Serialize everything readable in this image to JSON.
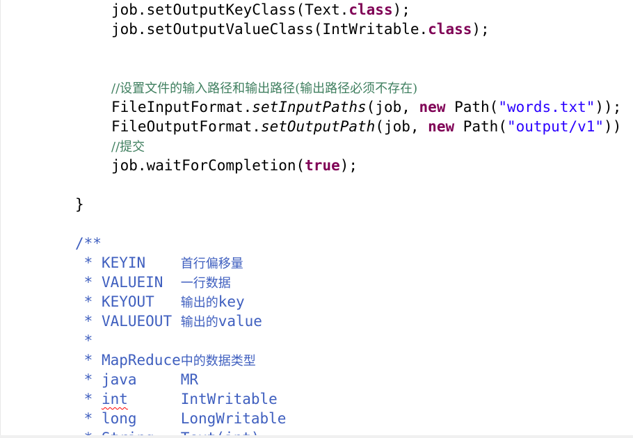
{
  "code": {
    "l1": {
      "pre": "job.setOutputKeyClass(Text.",
      "kw": "class",
      "post": ");"
    },
    "l2": {
      "pre": "job.setOutputValueClass(IntWritable.",
      "kw": "class",
      "post": ");"
    },
    "l3": {
      "comment": "//设置文件的输入路径和输出路径(输出路径必须不存在)"
    },
    "l4": {
      "pre": "FileInputFormat.",
      "method": "setInputPaths",
      "mid": "(job, ",
      "kw": "new",
      "mid2": " Path(",
      "str": "\"words.txt\"",
      "post": "));"
    },
    "l5": {
      "pre": "FileOutputFormat.",
      "method": "setOutputPath",
      "mid": "(job, ",
      "kw": "new",
      "mid2": " Path(",
      "str": "\"output/v1\"",
      "post": "))"
    },
    "l6": {
      "comment": "//提交"
    },
    "l7": {
      "pre": "job.waitForCompletion(",
      "kw": "true",
      "post": ");"
    },
    "l8": {
      "text": "}"
    }
  },
  "javadoc": {
    "open": "/**",
    "rows": [
      {
        "star": " * ",
        "a": "KEYIN    ",
        "b": "首行偏移量"
      },
      {
        "star": " * ",
        "a": "VALUEIN  ",
        "b": "一行数据"
      },
      {
        "star": " * ",
        "a": "KEYOUT   ",
        "b": "输出的",
        "c": "key"
      },
      {
        "star": " * ",
        "a": "VALUEOUT ",
        "b": "输出的",
        "c": "value"
      },
      {
        "star": " *",
        "a": "",
        "b": ""
      },
      {
        "star": " * ",
        "a": "MapReduce",
        "b": "中的数据类型"
      },
      {
        "star": " * ",
        "a": "java     ",
        "b": "",
        "c": "MR"
      },
      {
        "star": " * ",
        "a": "int",
        "a2": "      ",
        "b": "",
        "c": "IntWritable"
      },
      {
        "star": " * ",
        "a": "long     ",
        "b": "",
        "c": "LongWritable"
      },
      {
        "star": " * ",
        "a": "String   ",
        "b": "",
        "c": "Text(int)"
      }
    ]
  },
  "colors": {
    "keyword": "#7f0055",
    "string": "#2a00ff",
    "comment": "#3f7f5f",
    "javadoc": "#3f5fbf",
    "text": "#000000"
  }
}
